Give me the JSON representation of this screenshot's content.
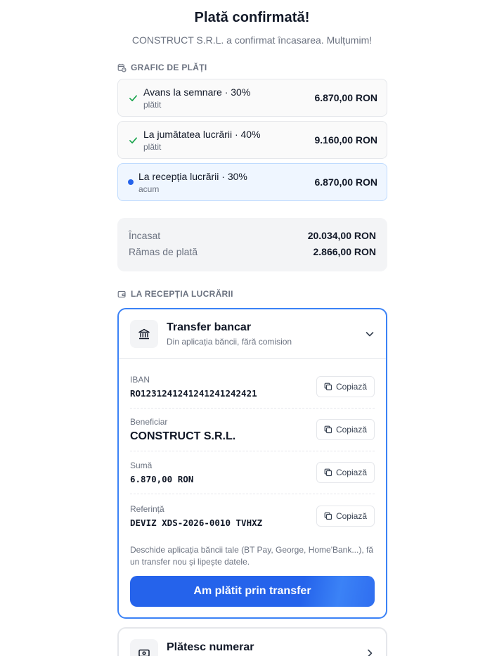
{
  "header": {
    "title": "Plată confirmată!",
    "subtitle": "CONSTRUCT S.R.L. a confirmat încasarea. Mulțumim!"
  },
  "schedule": {
    "section_label": "GRAFIC DE PLĂȚI",
    "items": [
      {
        "label": "Avans la semnare · 30%",
        "status": "plătit",
        "amount": "6.870,00 RON",
        "state": "paid"
      },
      {
        "label": "La jumătatea lucrării · 40%",
        "status": "plătit",
        "amount": "9.160,00 RON",
        "state": "paid"
      },
      {
        "label": "La recepția lucrării · 30%",
        "status": "acum",
        "amount": "6.870,00 RON",
        "state": "current"
      }
    ]
  },
  "totals": {
    "collected_label": "Încasat",
    "collected_value": "20.034,00 RON",
    "remaining_label": "Rămas de plată",
    "remaining_value": "2.866,00 RON"
  },
  "payment": {
    "section_label": "LA RECEPȚIA LUCRĂRII",
    "bank": {
      "title": "Transfer bancar",
      "subtitle": "Din aplicația băncii, fără comision",
      "fields": [
        {
          "label": "IBAN",
          "value": "RO1231241241241241242421"
        },
        {
          "label": "Beneficiar",
          "value": "CONSTRUCT S.R.L."
        },
        {
          "label": "Sumă",
          "value": "6.870,00 RON"
        },
        {
          "label": "Referință",
          "value": "DEVIZ XDS-2026-0010 TVHXZ"
        }
      ],
      "copy_label": "Copiază",
      "note": "Deschide aplicația băncii tale (BT Pay, George, Home'Bank...), fă un transfer nou și lipește datele.",
      "cta": "Am plătit prin transfer"
    },
    "cash": {
      "title": "Plătesc numerar"
    }
  },
  "colors": {
    "accent": "#2563eb",
    "success": "#16a34a",
    "muted_text": "#6b7280"
  }
}
